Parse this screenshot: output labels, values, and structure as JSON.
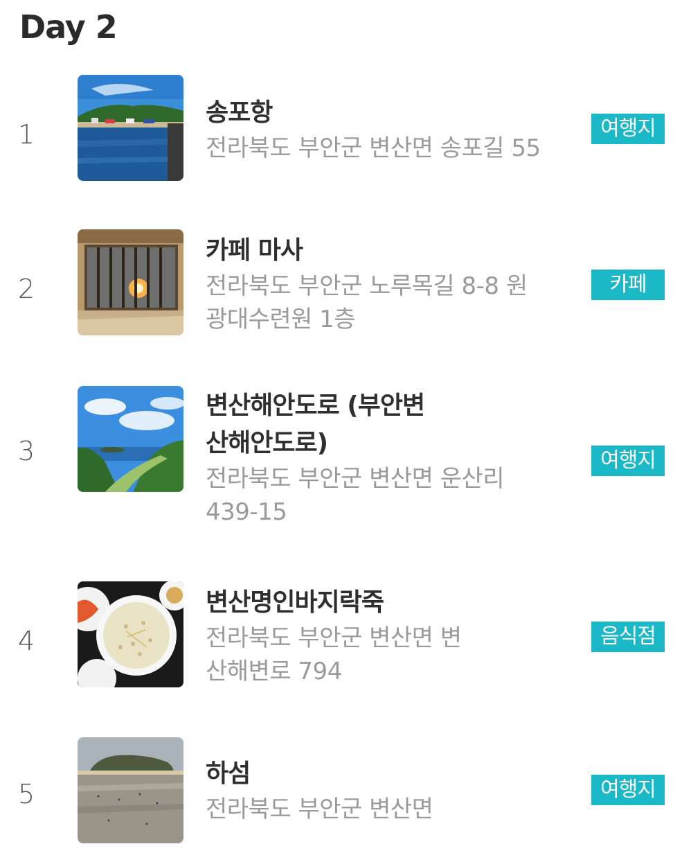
{
  "day_title": "Day 2",
  "items": [
    {
      "number": "1",
      "name": "송포항",
      "address": "전라북도 부안군 변산면 송포길 55",
      "category": "여행지",
      "thumbnail_icon": "harbor-photo"
    },
    {
      "number": "2",
      "name": "카페 마사",
      "address": "전라북도 부안군 노루목길 8-8 원광대수련원 1층",
      "category": "카페",
      "thumbnail_icon": "cafe-window-photo"
    },
    {
      "number": "3",
      "name": "변산해안도로 (부안변산해안도로)",
      "address": "전라북도 부안군 변산면 운산리 439-15",
      "category": "여행지",
      "thumbnail_icon": "coastal-road-photo"
    },
    {
      "number": "4",
      "name": "변산명인바지락죽",
      "address": "전라북도 부안군 변산면 변산해변로 794",
      "category": "음식점",
      "thumbnail_icon": "clam-porridge-photo"
    },
    {
      "number": "5",
      "name": "하섬",
      "address": "전라북도 부안군 변산면",
      "category": "여행지",
      "thumbnail_icon": "island-tidal-flat-photo"
    }
  ],
  "colors": {
    "tag_background": "#1bb8c8",
    "tag_text": "#ffffff",
    "name_text": "#2f2f2f",
    "address_text": "#9a9a9a"
  }
}
